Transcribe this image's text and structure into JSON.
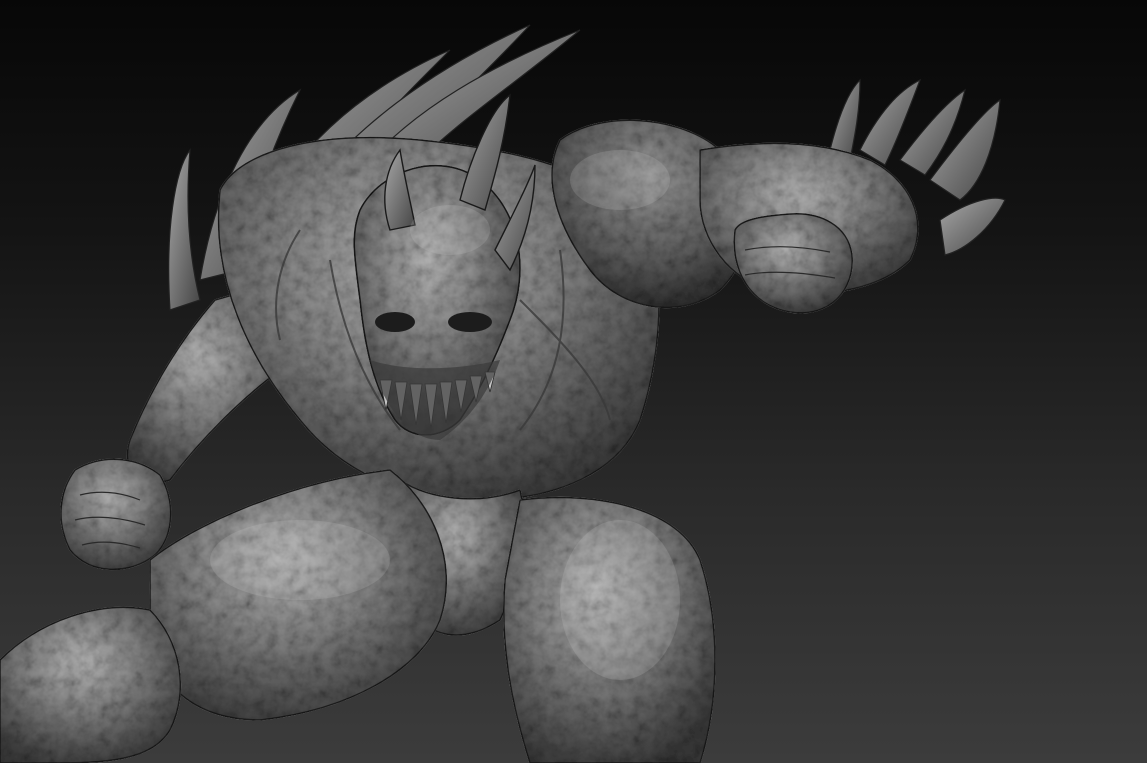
{
  "scene": {
    "background_top": "#070707",
    "background_bottom": "#3c3c3c",
    "material_highlight": "#b8b8b8",
    "material_mid": "#7a7a7a",
    "material_shadow": "#2b2b2b"
  },
  "subject": {
    "parts": [
      "back-spikes",
      "horns",
      "skull-face",
      "teeth",
      "torso",
      "shoulder-mass",
      "right-fist",
      "left-fist",
      "left-arm",
      "thighs",
      "left-shin"
    ]
  }
}
